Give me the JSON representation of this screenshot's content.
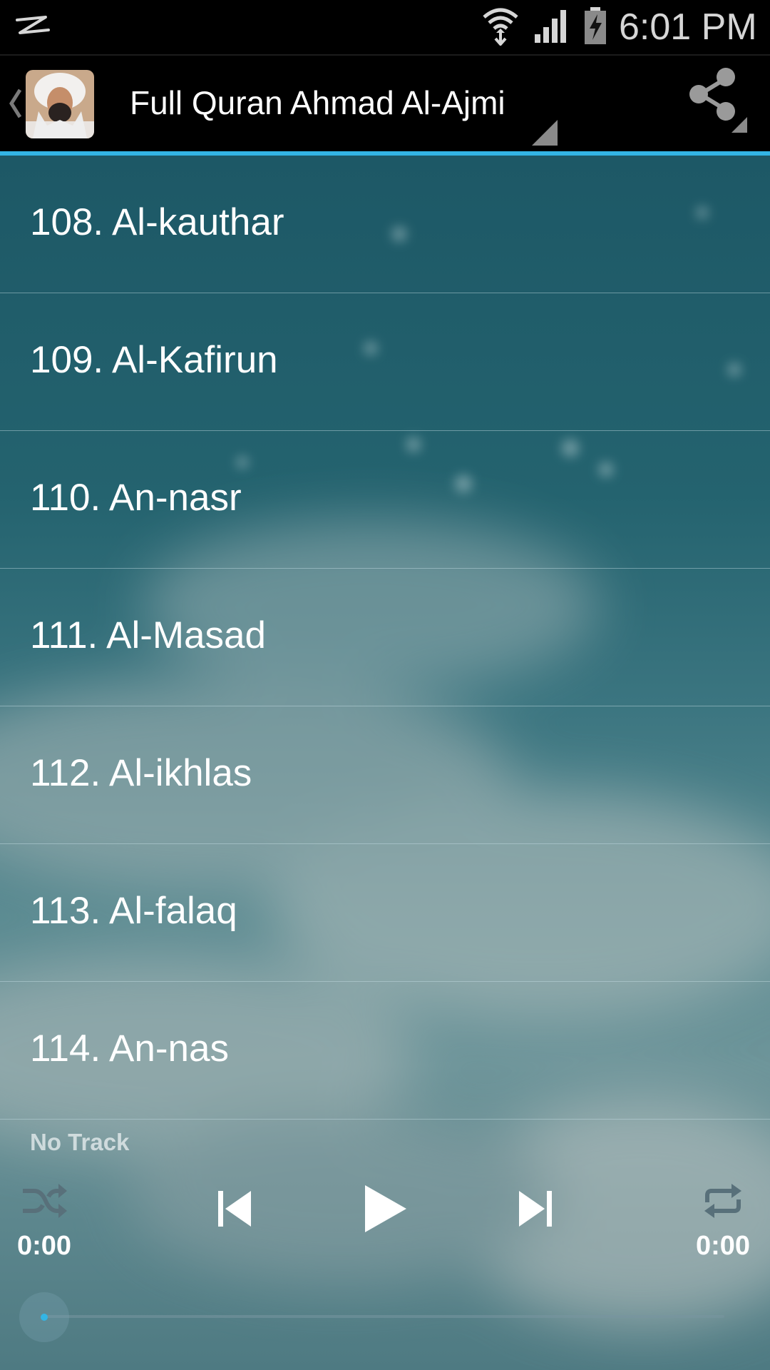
{
  "status_bar": {
    "time": "6:01 PM",
    "icons": [
      "notification-icon",
      "wifi-icon",
      "signal-icon",
      "battery-charging-icon"
    ]
  },
  "action_bar": {
    "title": "Full Quran Ahmad Al-Ajmi",
    "icons": [
      "up-caret-icon",
      "app-icon",
      "share-icon"
    ]
  },
  "surahs": [
    {
      "label": "108. Al-kauthar"
    },
    {
      "label": "109. Al-Kafirun"
    },
    {
      "label": "110. An-nasr"
    },
    {
      "label": "111. Al-Masad"
    },
    {
      "label": "112. Al-ikhlas"
    },
    {
      "label": "113. Al-falaq"
    },
    {
      "label": "114. An-nas"
    }
  ],
  "player": {
    "track": "No Track",
    "elapsed": "0:00",
    "duration": "0:00",
    "progress": 0,
    "icons": [
      "shuffle-icon",
      "previous-icon",
      "play-icon",
      "next-icon",
      "repeat-icon"
    ]
  },
  "colors": {
    "accent": "#33b5e5",
    "bar_background": "#000000",
    "list_text": "#ffffff"
  }
}
